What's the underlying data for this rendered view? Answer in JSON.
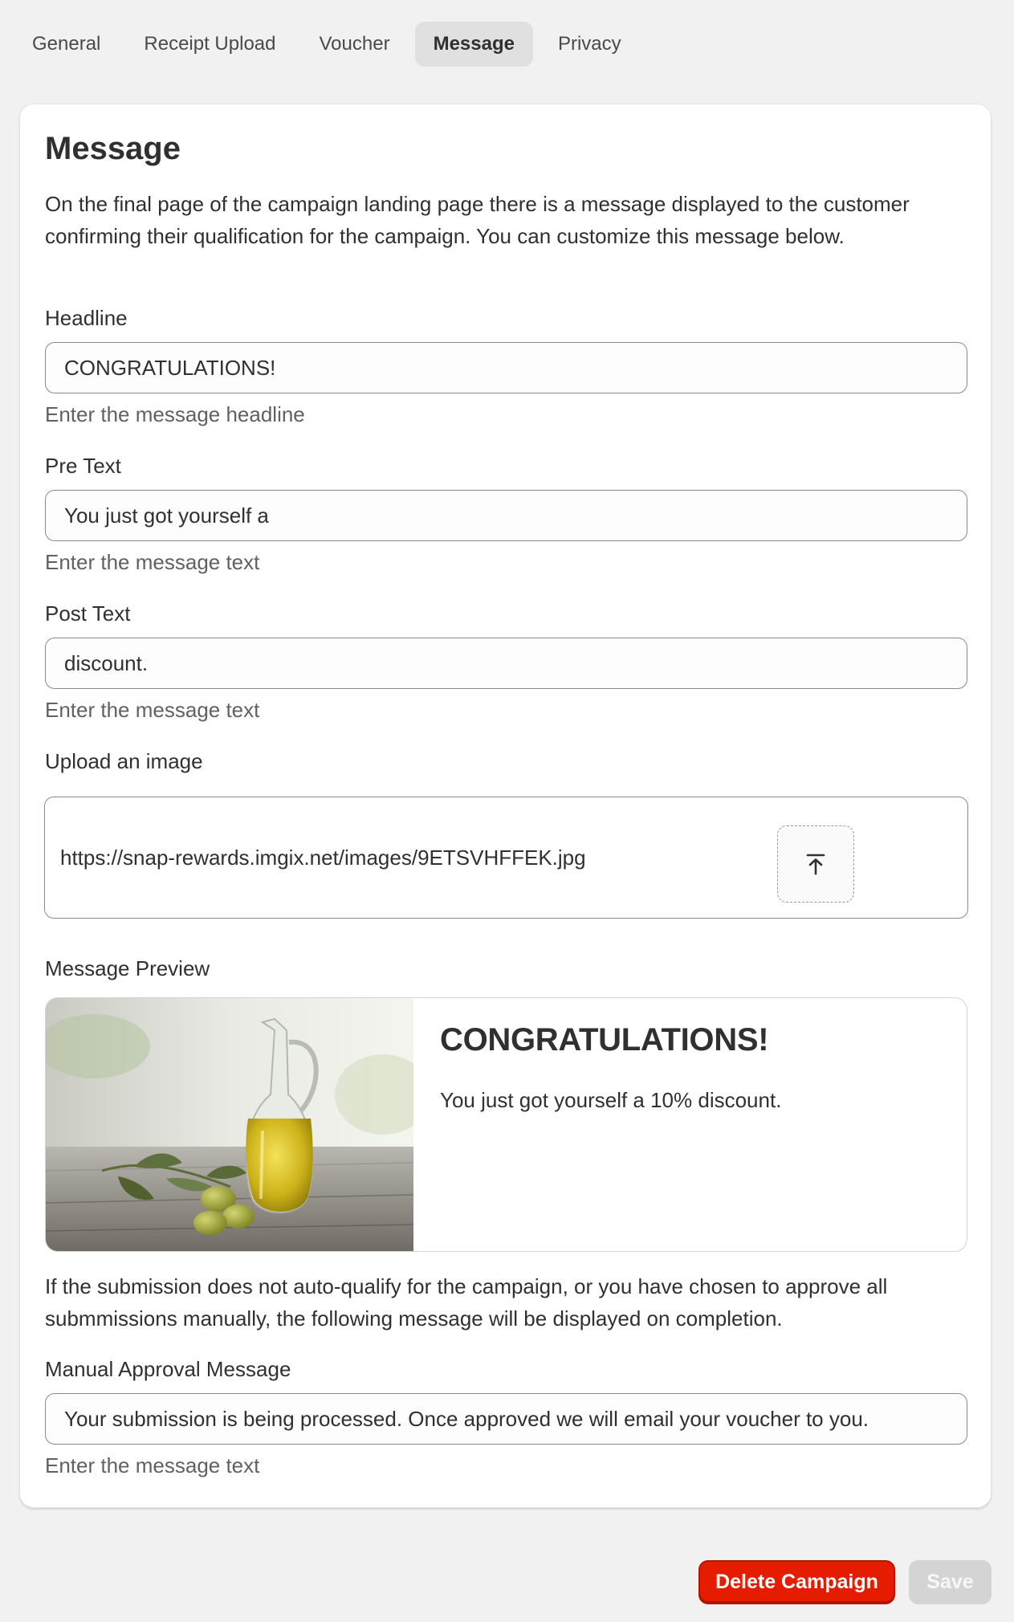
{
  "tabs": [
    {
      "label": "General"
    },
    {
      "label": "Receipt Upload"
    },
    {
      "label": "Voucher"
    },
    {
      "label": "Message",
      "active": true
    },
    {
      "label": "Privacy"
    }
  ],
  "card": {
    "title": "Message",
    "intro": "On the final page of the campaign landing page there is a message displayed to the customer confirming their qualification for the campaign. You can customize this message below."
  },
  "headline": {
    "label": "Headline",
    "value": "CONGRATULATIONS!",
    "help": "Enter the message headline"
  },
  "pre_text": {
    "label": "Pre Text",
    "value": "You just got yourself a",
    "help": "Enter the message text"
  },
  "post_text": {
    "label": "Post Text",
    "value": "discount.",
    "help": "Enter the message text"
  },
  "upload": {
    "label": "Upload an image",
    "url": "https://snap-rewards.imgix.net/images/9ETSVHFFEK.jpg",
    "icon": "upload-icon"
  },
  "preview": {
    "label": "Message Preview",
    "headline": "CONGRATULATIONS!",
    "text": "You just got yourself a 10% discount.",
    "image_subject": "olive oil jug"
  },
  "manual": {
    "description": "If the submission does not auto-qualify for the campaign, or you have chosen to approve all submmissions manually, the following message will be displayed on completion.",
    "label": "Manual Approval Message",
    "value": "Your submission is being processed. Once approved we will email your voucher to you.",
    "help": "Enter the message text"
  },
  "actions": {
    "delete_label": "Delete Campaign",
    "save_label": "Save"
  },
  "colors": {
    "page_bg": "#f1f1f1",
    "danger": "#e51c00",
    "disabled": "#d4d4d4"
  }
}
